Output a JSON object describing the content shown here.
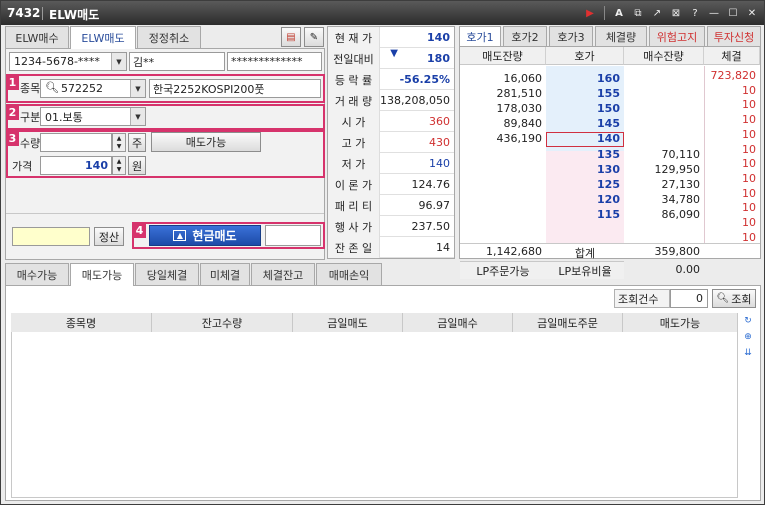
{
  "title": {
    "code": "7432",
    "name": "ELW매도"
  },
  "top_tabs": [
    "ELW매수",
    "ELW매도",
    "정정취소"
  ],
  "account": {
    "number": "1234-5678-****",
    "name": "김**",
    "password": "*************"
  },
  "form": {
    "num1": "1",
    "num2": "2",
    "num3": "3",
    "num4": "4",
    "stock_label_partial": "종목",
    "stock_code": "572252",
    "stock_name": "한국2252KOSPI200풋",
    "type_label_partial": "구분",
    "type_value": "01.보통",
    "qty_label_partial": "수량",
    "qty_unit": "주",
    "available_button": "매도가능",
    "price_label": "가격",
    "price_value": "140",
    "price_unit": "원",
    "settle_button": "정산",
    "sell_button": "현금매도"
  },
  "price_info": [
    {
      "key": "현 재 가",
      "value": "140",
      "color": "#1a3fa8",
      "bold": true
    },
    {
      "key": "전일대비",
      "value": "180",
      "prefix": "▼",
      "color": "#1a3fa8",
      "bold": true
    },
    {
      "key": "등 락 률",
      "value": "-56.25%",
      "color": "#1a3fa8",
      "bold": true
    },
    {
      "key": "거 래 량",
      "value": "138,208,050",
      "color": "#222"
    },
    {
      "key": "시 가",
      "value": "360",
      "color": "#d03030"
    },
    {
      "key": "고 가",
      "value": "430",
      "color": "#d03030"
    },
    {
      "key": "저 가",
      "value": "140",
      "color": "#1a3fa8"
    },
    {
      "key": "이 론 가",
      "value": "124.76",
      "color": "#222"
    },
    {
      "key": "패 리 티",
      "value": "96.97",
      "color": "#222"
    },
    {
      "key": "행 사 가",
      "value": "237.50",
      "color": "#222"
    },
    {
      "key": "잔 존 일",
      "value": "14",
      "color": "#222"
    }
  ],
  "orderbook": {
    "tabs": [
      "호가1",
      "호가2",
      "호가3",
      "체결량",
      "위험고지",
      "투자신청"
    ],
    "headers": [
      "매도잔량",
      "호가",
      "매수잔량",
      "체결"
    ],
    "asks": [
      {
        "qty": "16,060",
        "price": "160"
      },
      {
        "qty": "281,510",
        "price": "155"
      },
      {
        "qty": "178,030",
        "price": "150"
      },
      {
        "qty": "89,840",
        "price": "145"
      },
      {
        "qty": "436,190",
        "price": "140"
      }
    ],
    "bids": [
      {
        "price": "135",
        "qty": "70,110"
      },
      {
        "price": "130",
        "qty": "129,950"
      },
      {
        "price": "125",
        "qty": "27,130"
      },
      {
        "price": "120",
        "qty": "34,780"
      },
      {
        "price": "115",
        "qty": "86,090"
      }
    ],
    "trades": [
      "723,820",
      "10",
      "10",
      "10",
      "10",
      "10",
      "10",
      "10",
      "10",
      "10",
      "10",
      "10"
    ],
    "total_ask": "1,142,680",
    "total_label": "합계",
    "total_bid": "359,800",
    "lp_order_label": "LP주문가능",
    "lp_hold_label": "LP보유비율",
    "lp_hold_value": "0.00"
  },
  "bottom_tabs": [
    "매수가능",
    "매도가능",
    "당일체결",
    "미체결",
    "체결잔고",
    "매매손익"
  ],
  "query": {
    "count_label": "조회건수",
    "count_value": "0",
    "button": "조회"
  },
  "grid_headers": [
    "종목명",
    "잔고수량",
    "금일매도",
    "금일매수",
    "금일매도주문",
    "매도가능"
  ]
}
